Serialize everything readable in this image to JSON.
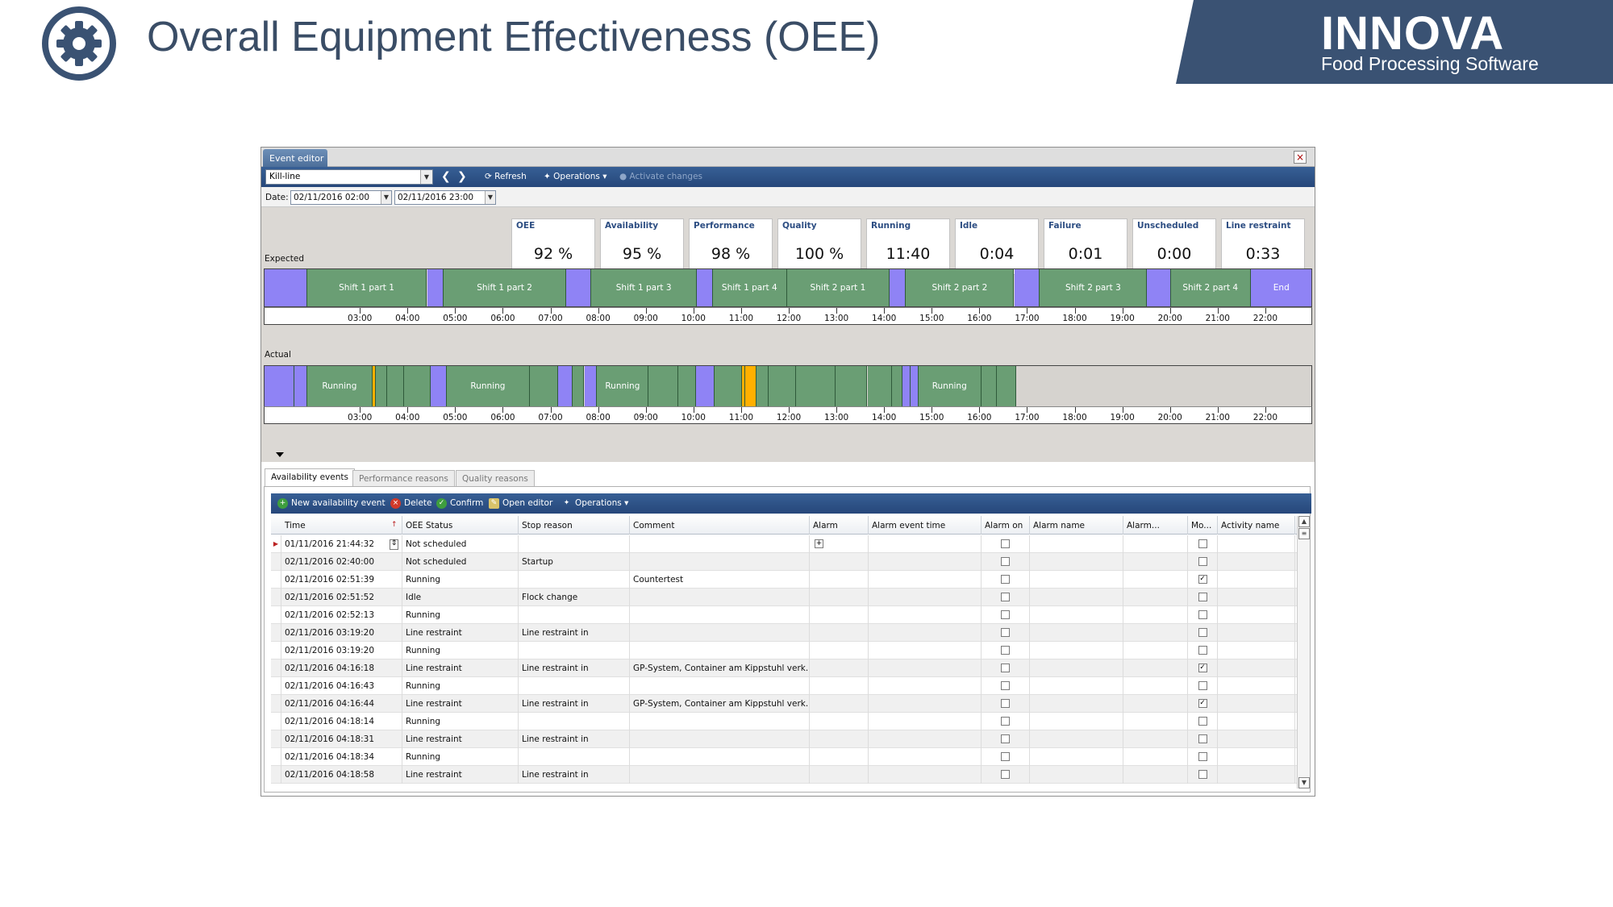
{
  "slide": {
    "title": "Overall Equipment Effectiveness (OEE)",
    "brand_name": "INNOVA",
    "brand_sub": "Food Processing Software"
  },
  "colors": {
    "title": "#3a4d66",
    "brand_bg": "#3a5273",
    "scheduled": "#6a9e74",
    "unscheduled": "#8f83f5",
    "alarm": "#ffb000"
  },
  "window": {
    "tab": "Event editor",
    "close": "×"
  },
  "toolbar": {
    "line": "Kill-line",
    "refresh": "Refresh",
    "operations": "Operations",
    "activate": "Activate changes"
  },
  "datebar": {
    "label": "Date:",
    "from": "02/11/2016 02:00",
    "to": "02/11/2016 23:00"
  },
  "kpis": [
    {
      "label": "OEE",
      "value": "92 %"
    },
    {
      "label": "Availability",
      "value": "95 %"
    },
    {
      "label": "Performance",
      "value": "98 %"
    },
    {
      "label": "Quality",
      "value": "100 %"
    },
    {
      "label": "Running",
      "value": "11:40"
    },
    {
      "label": "Idle",
      "value": "0:04"
    },
    {
      "label": "Failure",
      "value": "0:01"
    },
    {
      "label": "Unscheduled",
      "value": "0:00"
    },
    {
      "label": "Line restraint",
      "value": "0:33"
    }
  ],
  "timeline": {
    "expected_label": "Expected",
    "actual_label": "Actual",
    "hours": [
      "03:00",
      "04:00",
      "05:00",
      "06:00",
      "07:00",
      "08:00",
      "09:00",
      "10:00",
      "11:00",
      "12:00",
      "13:00",
      "14:00",
      "15:00",
      "16:00",
      "17:00",
      "18:00",
      "19:00",
      "20:00",
      "21:00",
      "22:00"
    ],
    "expected": [
      {
        "start": 0.0,
        "end": 0.89,
        "kind": "unsched",
        "label": ""
      },
      {
        "start": 0.89,
        "end": 3.41,
        "kind": "sched",
        "label": "Shift 1 part 1"
      },
      {
        "start": 3.41,
        "end": 3.76,
        "kind": "unsched",
        "label": ""
      },
      {
        "start": 3.76,
        "end": 6.33,
        "kind": "sched",
        "label": "Shift 1 part 2"
      },
      {
        "start": 6.33,
        "end": 6.86,
        "kind": "unsched",
        "label": ""
      },
      {
        "start": 6.86,
        "end": 9.07,
        "kind": "sched",
        "label": "Shift 1 part 3"
      },
      {
        "start": 9.07,
        "end": 9.41,
        "kind": "unsched",
        "label": ""
      },
      {
        "start": 9.41,
        "end": 10.96,
        "kind": "sched",
        "label": "Shift 1 part 4"
      },
      {
        "start": 10.96,
        "end": 13.12,
        "kind": "sched",
        "label": "Shift 2 part 1"
      },
      {
        "start": 13.12,
        "end": 13.46,
        "kind": "unsched",
        "label": ""
      },
      {
        "start": 13.46,
        "end": 15.73,
        "kind": "sched",
        "label": "Shift 2 part 2"
      },
      {
        "start": 15.73,
        "end": 16.27,
        "kind": "unsched",
        "label": ""
      },
      {
        "start": 16.27,
        "end": 18.52,
        "kind": "sched",
        "label": "Shift 2 part 3"
      },
      {
        "start": 18.52,
        "end": 19.02,
        "kind": "unsched",
        "label": ""
      },
      {
        "start": 19.02,
        "end": 20.69,
        "kind": "sched",
        "label": "Shift 2 part 4"
      },
      {
        "start": 20.69,
        "end": 22.0,
        "kind": "unsched",
        "label": "End"
      }
    ],
    "actual": [
      {
        "start": 0.0,
        "end": 0.63,
        "kind": "unsched",
        "label": ""
      },
      {
        "start": 0.63,
        "end": 0.89,
        "kind": "unsched",
        "label": ""
      },
      {
        "start": 0.89,
        "end": 2.27,
        "kind": "sched",
        "label": "Running"
      },
      {
        "start": 2.27,
        "end": 2.33,
        "kind": "alarm",
        "label": ""
      },
      {
        "start": 2.33,
        "end": 2.58,
        "kind": "sched",
        "label": ""
      },
      {
        "start": 2.58,
        "end": 2.93,
        "kind": "sched",
        "label": ""
      },
      {
        "start": 2.93,
        "end": 3.48,
        "kind": "sched",
        "label": ""
      },
      {
        "start": 3.48,
        "end": 3.83,
        "kind": "unsched",
        "label": ""
      },
      {
        "start": 3.83,
        "end": 5.56,
        "kind": "sched",
        "label": "Running"
      },
      {
        "start": 5.56,
        "end": 6.16,
        "kind": "sched",
        "label": ""
      },
      {
        "start": 6.16,
        "end": 6.46,
        "kind": "unsched",
        "label": ""
      },
      {
        "start": 6.46,
        "end": 6.71,
        "kind": "sched",
        "label": ""
      },
      {
        "start": 6.71,
        "end": 6.98,
        "kind": "unsched",
        "label": ""
      },
      {
        "start": 6.98,
        "end": 8.06,
        "kind": "sched",
        "label": "Running"
      },
      {
        "start": 8.06,
        "end": 8.68,
        "kind": "sched",
        "label": ""
      },
      {
        "start": 8.68,
        "end": 9.05,
        "kind": "sched",
        "label": ""
      },
      {
        "start": 9.05,
        "end": 9.44,
        "kind": "unsched",
        "label": ""
      },
      {
        "start": 9.44,
        "end": 10.02,
        "kind": "sched",
        "label": ""
      },
      {
        "start": 10.02,
        "end": 10.09,
        "kind": "alarm",
        "label": ""
      },
      {
        "start": 10.09,
        "end": 10.32,
        "kind": "alarm",
        "label": ""
      },
      {
        "start": 10.32,
        "end": 10.58,
        "kind": "sched",
        "label": ""
      },
      {
        "start": 10.58,
        "end": 11.15,
        "kind": "sched",
        "label": ""
      },
      {
        "start": 11.15,
        "end": 11.98,
        "kind": "sched",
        "label": ""
      },
      {
        "start": 11.98,
        "end": 12.65,
        "kind": "sched",
        "label": ""
      },
      {
        "start": 12.65,
        "end": 13.17,
        "kind": "sched",
        "label": ""
      },
      {
        "start": 13.17,
        "end": 13.38,
        "kind": "sched",
        "label": ""
      },
      {
        "start": 13.38,
        "end": 13.56,
        "kind": "unsched",
        "label": ""
      },
      {
        "start": 13.56,
        "end": 13.72,
        "kind": "unsched",
        "label": ""
      },
      {
        "start": 13.72,
        "end": 15.04,
        "kind": "sched",
        "label": "Running"
      },
      {
        "start": 15.04,
        "end": 15.36,
        "kind": "sched",
        "label": ""
      },
      {
        "start": 15.36,
        "end": 15.78,
        "kind": "sched",
        "label": ""
      },
      {
        "start": 15.78,
        "end": 22.0,
        "kind": "none",
        "label": ""
      }
    ]
  },
  "lower": {
    "tabs": [
      "Availability events",
      "Performance reasons",
      "Quality reasons"
    ],
    "toolbar": {
      "new": "New availability event",
      "delete": "Delete",
      "confirm": "Confirm",
      "open_editor": "Open editor",
      "operations": "Operations"
    },
    "columns": [
      "Time",
      "OEE Status",
      "Stop reason",
      "Comment",
      "Alarm",
      "Alarm event time",
      "Alarm on",
      "Alarm name",
      "Alarm...",
      "Mo...",
      "Activity name"
    ],
    "rows": [
      {
        "time": "01/11/2016 21:44:32",
        "status": "Not scheduled",
        "reason": "",
        "comment": "",
        "mo": false
      },
      {
        "time": "02/11/2016 02:40:00",
        "status": "Not scheduled",
        "reason": "Startup",
        "comment": "",
        "mo": false
      },
      {
        "time": "02/11/2016 02:51:39",
        "status": "Running",
        "reason": "",
        "comment": "Countertest",
        "mo": true
      },
      {
        "time": "02/11/2016 02:51:52",
        "status": "Idle",
        "reason": "Flock change",
        "comment": "",
        "mo": false
      },
      {
        "time": "02/11/2016 02:52:13",
        "status": "Running",
        "reason": "",
        "comment": "",
        "mo": false
      },
      {
        "time": "02/11/2016 03:19:20",
        "status": "Line restraint",
        "reason": "Line restraint in",
        "comment": "",
        "mo": false
      },
      {
        "time": "02/11/2016 03:19:20",
        "status": "Running",
        "reason": "",
        "comment": "",
        "mo": false
      },
      {
        "time": "02/11/2016 04:16:18",
        "status": "Line restraint",
        "reason": "Line restraint in",
        "comment": "GP-System, Container am Kippstuhl verk...",
        "mo": true
      },
      {
        "time": "02/11/2016 04:16:43",
        "status": "Running",
        "reason": "",
        "comment": "",
        "mo": false
      },
      {
        "time": "02/11/2016 04:16:44",
        "status": "Line restraint",
        "reason": "Line restraint in",
        "comment": "GP-System, Container am Kippstuhl verk...",
        "mo": true
      },
      {
        "time": "02/11/2016 04:18:14",
        "status": "Running",
        "reason": "",
        "comment": "",
        "mo": false
      },
      {
        "time": "02/11/2016 04:18:31",
        "status": "Line restraint",
        "reason": "Line restraint in",
        "comment": "",
        "mo": false
      },
      {
        "time": "02/11/2016 04:18:34",
        "status": "Running",
        "reason": "",
        "comment": "",
        "mo": false
      },
      {
        "time": "02/11/2016 04:18:58",
        "status": "Line restraint",
        "reason": "Line restraint in",
        "comment": "",
        "mo": false
      }
    ]
  }
}
